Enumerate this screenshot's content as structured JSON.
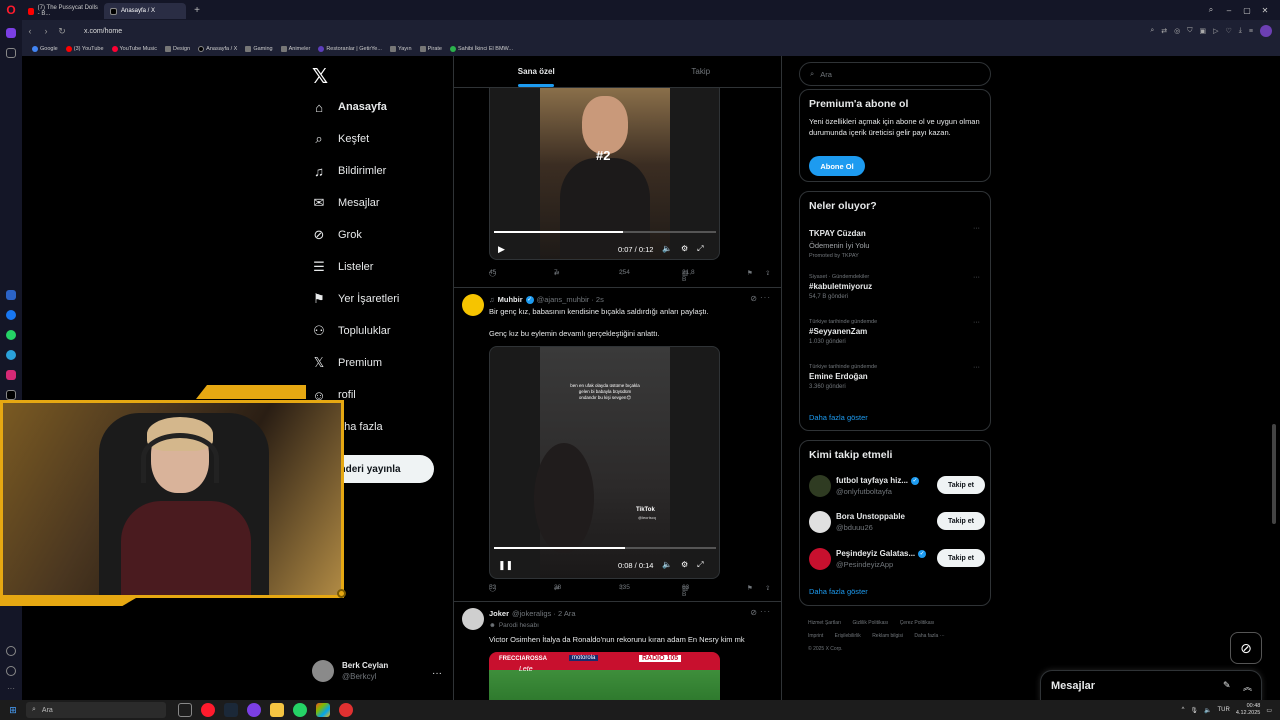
{
  "browser": {
    "tabs": [
      {
        "label": "(7) The Pussycat Dolls - B...",
        "active": false
      },
      {
        "label": "Anasayfa / X",
        "active": true
      }
    ],
    "url": "x.com/home",
    "bookmarks": [
      "Google",
      "(3) YouTube",
      "YouTube Music",
      "Design",
      "Anasayfa / X",
      "Gaming",
      "Animeler",
      "Restoranlar | GetirYe...",
      "Yayın",
      "Pirate",
      "Sahibi İkinci El BMW..."
    ]
  },
  "nav": {
    "items": [
      {
        "label": "Anasayfa",
        "icon": "home-icon"
      },
      {
        "label": "Keşfet",
        "icon": "search-icon"
      },
      {
        "label": "Bildirimler",
        "icon": "bell-icon"
      },
      {
        "label": "Mesajlar",
        "icon": "mail-icon"
      },
      {
        "label": "Grok",
        "icon": "grok-icon"
      },
      {
        "label": "Listeler",
        "icon": "list-icon"
      },
      {
        "label": "Yer İşaretleri",
        "icon": "bookmark-icon"
      },
      {
        "label": "Topluluklar",
        "icon": "communities-icon"
      },
      {
        "label": "Premium",
        "icon": "x-premium-icon"
      },
      {
        "label": "rofil",
        "icon": "profile-icon"
      },
      {
        "label": "aha fazla",
        "icon": "more-icon"
      }
    ],
    "post_button": "önderi yayınla",
    "profile": {
      "name": "Berk Ceylan",
      "handle": "@Berkcyl"
    }
  },
  "feed": {
    "tabs": [
      "Sana özel",
      "Takip"
    ],
    "tweet1": {
      "video_overlay": "#2",
      "time": "0:07 / 0:12",
      "progress": 0.58,
      "stats": {
        "replies": "45",
        "reposts": "7",
        "likes": "254",
        "views": "21,8 B"
      }
    },
    "tweet2": {
      "name": "Muhbir",
      "handle": "@ajans_muhbir · 2s",
      "text1": "Bir genç kız, babasının kendisine bıçakla saldırdığı anları paylaştı.",
      "text2": "Genç kız bu eylemin devamlı gerçekleştiğini anlattı.",
      "video_caption": "ben en ufak olayda üstüme bıçakla gelen bi babayla büyüdüm ondandır bu kişi sevgen😊",
      "tiktok_label": "TikTok",
      "tiktok_handle": "@leoriscq",
      "time": "0:08 / 0:14",
      "progress": 0.59,
      "stats": {
        "replies": "52",
        "reposts": "38",
        "likes": "335",
        "views": "63 B"
      }
    },
    "tweet3": {
      "name": "Joker",
      "handle": "@jokeraligs · 2 Ara",
      "badge": "Parodi hesabı",
      "text": "Victor Osimhen İtalya da Ronaldo'nun rekorunu kıran adam En Nesry kim mk",
      "image_labels": [
        "FRECCIAROSSA",
        "motorola",
        "RADIO 105",
        "Lete"
      ]
    }
  },
  "sidebar": {
    "search_placeholder": "Ara",
    "premium": {
      "title": "Premium'a abone ol",
      "text": "Yeni özellikleri açmak için abone ol ve uygun olman durumunda içerik üreticisi gelir payı kazan.",
      "button": "Abone Ol"
    },
    "trends": {
      "title": "Neler oluyor?",
      "items": [
        {
          "context": "",
          "title": "TKPAY Cüzdan",
          "sub": "Ödemenin İyi Yolu",
          "count": "Promoted by TKPAY"
        },
        {
          "context": "Siyaset · Gündemdekiler",
          "title": "#kabuletmiyoruz",
          "sub": "",
          "count": "54,7 B gönderi"
        },
        {
          "context": "Türkiye tarihinde gündemde",
          "title": "#SeyyanenZam",
          "sub": "",
          "count": "1.030 gönderi"
        },
        {
          "context": "Türkiye tarihinde gündemde",
          "title": "Emine Erdoğan",
          "sub": "",
          "count": "3.360 gönderi"
        }
      ],
      "more": "Daha fazla göster"
    },
    "who_to_follow": {
      "title": "Kimi takip etmeli",
      "items": [
        {
          "name": "futbol tayfaya hiz...",
          "handle": "@onlyfutboltayfa",
          "verified": true,
          "button": "Takip et"
        },
        {
          "name": "Bora Unstoppable",
          "handle": "@bduuu26",
          "verified": false,
          "button": "Takip et"
        },
        {
          "name": "Peşindeyiz Galatas...",
          "handle": "@PesindeyizApp",
          "verified": true,
          "button": "Takip et"
        }
      ],
      "more": "Daha fazla göster"
    },
    "footer": [
      "Hizmet Şartları",
      "Gizlilik Politikası",
      "Çerez Politikası",
      "Imprint",
      "Erişilebilirlik",
      "Reklam bilgisi",
      "Daha fazla ···",
      "© 2025 X Corp."
    ]
  },
  "messages_drawer": {
    "title": "Mesajlar"
  },
  "taskbar": {
    "search": "Ara",
    "lang": "TUR",
    "time": "00:48",
    "date": "4.12.2025"
  }
}
